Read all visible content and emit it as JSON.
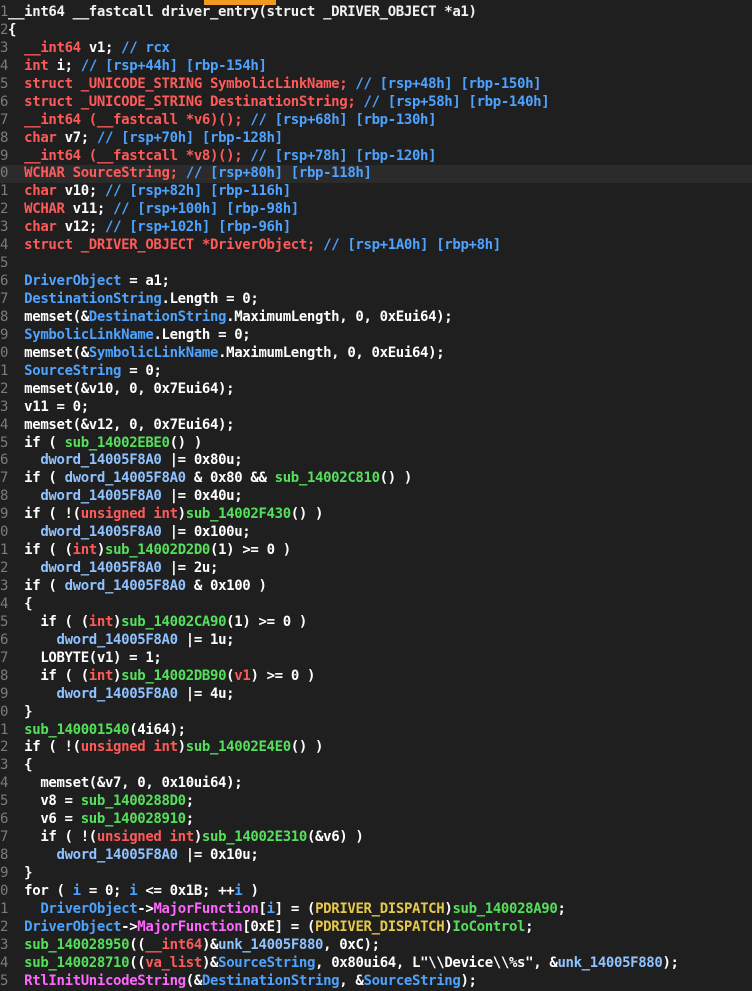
{
  "window": {
    "title": ""
  },
  "colors": {
    "background": "#1f1f1f",
    "current_line": "#2b2b2b",
    "line_number": "#7c7c7c",
    "comment": "#4da3ff",
    "type_keyword": "#ff5a5a",
    "function": "#55e05c",
    "global_var": "#8fc2ff",
    "member": "#ff66ff"
  },
  "code": {
    "highlighted_line": 9,
    "lines": [
      {
        "n": "1",
        "segs": [
          {
            "t": "__int64 __fastcall driver_entry(struct _DRIVER_OBJECT *a1)",
            "c": "k"
          }
        ]
      },
      {
        "n": "2",
        "segs": [
          {
            "t": "{",
            "c": "p"
          }
        ]
      },
      {
        "n": "3",
        "segs": [
          {
            "t": "  ",
            "c": "p"
          },
          {
            "t": "__int64",
            "c": "t"
          },
          {
            "t": " v1; ",
            "c": "v"
          },
          {
            "t": "// rcx",
            "c": "c"
          }
        ]
      },
      {
        "n": "4",
        "segs": [
          {
            "t": "  ",
            "c": "p"
          },
          {
            "t": "int",
            "c": "t"
          },
          {
            "t": " i; ",
            "c": "v"
          },
          {
            "t": "// [rsp+44h] [rbp-154h]",
            "c": "c"
          }
        ]
      },
      {
        "n": "5",
        "segs": [
          {
            "t": "  ",
            "c": "p"
          },
          {
            "t": "struct _UNICODE_STRING SymbolicLinkName;",
            "c": "t"
          },
          {
            "t": " ",
            "c": "p"
          },
          {
            "t": "// [rsp+48h] [rbp-150h]",
            "c": "c"
          }
        ]
      },
      {
        "n": "6",
        "segs": [
          {
            "t": "  ",
            "c": "p"
          },
          {
            "t": "struct _UNICODE_STRING DestinationString;",
            "c": "t"
          },
          {
            "t": " ",
            "c": "p"
          },
          {
            "t": "// [rsp+58h] [rbp-140h]",
            "c": "c"
          }
        ]
      },
      {
        "n": "7",
        "segs": [
          {
            "t": "  ",
            "c": "p"
          },
          {
            "t": "__int64 (__fastcall *v6)();",
            "c": "t"
          },
          {
            "t": " ",
            "c": "p"
          },
          {
            "t": "// [rsp+68h] [rbp-130h]",
            "c": "c"
          }
        ]
      },
      {
        "n": "8",
        "segs": [
          {
            "t": "  ",
            "c": "p"
          },
          {
            "t": "char",
            "c": "t"
          },
          {
            "t": " v7; ",
            "c": "v"
          },
          {
            "t": "// [rsp+70h] [rbp-128h]",
            "c": "c"
          }
        ]
      },
      {
        "n": "9",
        "segs": [
          {
            "t": "  ",
            "c": "p"
          },
          {
            "t": "__int64 (__fastcall *v8)();",
            "c": "t"
          },
          {
            "t": " ",
            "c": "p"
          },
          {
            "t": "// [rsp+78h] [rbp-120h]",
            "c": "c"
          }
        ]
      },
      {
        "n": "0",
        "segs": [
          {
            "t": "  ",
            "c": "p"
          },
          {
            "t": "WCHAR SourceString;",
            "c": "t"
          },
          {
            "t": " ",
            "c": "p"
          },
          {
            "t": "// [rsp+80h] [rbp-118h]",
            "c": "c"
          }
        ]
      },
      {
        "n": "1",
        "segs": [
          {
            "t": "  ",
            "c": "p"
          },
          {
            "t": "char",
            "c": "t"
          },
          {
            "t": " v10; ",
            "c": "v"
          },
          {
            "t": "// [rsp+82h] [rbp-116h]",
            "c": "c"
          }
        ]
      },
      {
        "n": "2",
        "segs": [
          {
            "t": "  ",
            "c": "p"
          },
          {
            "t": "WCHAR",
            "c": "t"
          },
          {
            "t": " v11; ",
            "c": "v"
          },
          {
            "t": "// [rsp+100h] [rbp-98h]",
            "c": "c"
          }
        ]
      },
      {
        "n": "3",
        "segs": [
          {
            "t": "  ",
            "c": "p"
          },
          {
            "t": "char",
            "c": "t"
          },
          {
            "t": " v12; ",
            "c": "v"
          },
          {
            "t": "// [rsp+102h] [rbp-96h]",
            "c": "c"
          }
        ]
      },
      {
        "n": "4",
        "segs": [
          {
            "t": "  ",
            "c": "p"
          },
          {
            "t": "struct _DRIVER_OBJECT *DriverObject;",
            "c": "t"
          },
          {
            "t": " ",
            "c": "p"
          },
          {
            "t": "// [rsp+1A0h] [rbp+8h]",
            "c": "c"
          }
        ]
      },
      {
        "n": "5",
        "segs": []
      },
      {
        "n": "6",
        "segs": [
          {
            "t": "  ",
            "c": "p"
          },
          {
            "t": "DriverObject",
            "c": "c"
          },
          {
            "t": " = a1;",
            "c": "v"
          }
        ]
      },
      {
        "n": "7",
        "segs": [
          {
            "t": "  ",
            "c": "p"
          },
          {
            "t": "DestinationString",
            "c": "c"
          },
          {
            "t": ".Length = 0;",
            "c": "p"
          }
        ]
      },
      {
        "n": "8",
        "segs": [
          {
            "t": "  memset(&",
            "c": "p"
          },
          {
            "t": "DestinationString",
            "c": "c"
          },
          {
            "t": ".MaximumLength, 0, 0xEui64);",
            "c": "p"
          }
        ]
      },
      {
        "n": "9",
        "segs": [
          {
            "t": "  ",
            "c": "p"
          },
          {
            "t": "SymbolicLinkName",
            "c": "c"
          },
          {
            "t": ".Length = 0;",
            "c": "p"
          }
        ]
      },
      {
        "n": "0",
        "segs": [
          {
            "t": "  memset(&",
            "c": "p"
          },
          {
            "t": "SymbolicLinkName",
            "c": "c"
          },
          {
            "t": ".MaximumLength, 0, 0xEui64);",
            "c": "p"
          }
        ]
      },
      {
        "n": "1",
        "segs": [
          {
            "t": "  ",
            "c": "p"
          },
          {
            "t": "SourceString",
            "c": "c"
          },
          {
            "t": " = 0;",
            "c": "p"
          }
        ]
      },
      {
        "n": "2",
        "segs": [
          {
            "t": "  memset(&v10, 0, 0x7Eui64);",
            "c": "p"
          }
        ]
      },
      {
        "n": "3",
        "segs": [
          {
            "t": "  v11 = 0;",
            "c": "p"
          }
        ]
      },
      {
        "n": "4",
        "segs": [
          {
            "t": "  memset(&v12, 0, 0x7Eui64);",
            "c": "p"
          }
        ]
      },
      {
        "n": "5",
        "segs": [
          {
            "t": "  if ( ",
            "c": "p"
          },
          {
            "t": "sub_14002EBE0",
            "c": "f"
          },
          {
            "t": "() )",
            "c": "p"
          }
        ]
      },
      {
        "n": "6",
        "segs": [
          {
            "t": "    ",
            "c": "p"
          },
          {
            "t": "dword_14005F8A0",
            "c": "g"
          },
          {
            "t": " |= 0x80u;",
            "c": "p"
          }
        ]
      },
      {
        "n": "7",
        "segs": [
          {
            "t": "  if ( ",
            "c": "p"
          },
          {
            "t": "dword_14005F8A0",
            "c": "g"
          },
          {
            "t": " & 0x80 && ",
            "c": "p"
          },
          {
            "t": "sub_14002C810",
            "c": "f"
          },
          {
            "t": "() )",
            "c": "p"
          }
        ]
      },
      {
        "n": "8",
        "segs": [
          {
            "t": "    ",
            "c": "p"
          },
          {
            "t": "dword_14005F8A0",
            "c": "g"
          },
          {
            "t": " |= 0x40u;",
            "c": "p"
          }
        ]
      },
      {
        "n": "9",
        "segs": [
          {
            "t": "  if ( !(",
            "c": "p"
          },
          {
            "t": "unsigned int",
            "c": "t2"
          },
          {
            "t": ")",
            "c": "p"
          },
          {
            "t": "sub_14002F430",
            "c": "f"
          },
          {
            "t": "() )",
            "c": "p"
          }
        ]
      },
      {
        "n": "0",
        "segs": [
          {
            "t": "    ",
            "c": "p"
          },
          {
            "t": "dword_14005F8A0",
            "c": "g"
          },
          {
            "t": " |= 0x100u;",
            "c": "p"
          }
        ]
      },
      {
        "n": "1",
        "segs": [
          {
            "t": "  if ( (",
            "c": "p"
          },
          {
            "t": "int",
            "c": "t2"
          },
          {
            "t": ")",
            "c": "p"
          },
          {
            "t": "sub_14002D2D0",
            "c": "f"
          },
          {
            "t": "(1) >= 0 )",
            "c": "p"
          }
        ]
      },
      {
        "n": "2",
        "segs": [
          {
            "t": "    ",
            "c": "p"
          },
          {
            "t": "dword_14005F8A0",
            "c": "g"
          },
          {
            "t": " |= 2u;",
            "c": "p"
          }
        ]
      },
      {
        "n": "3",
        "segs": [
          {
            "t": "  if ( ",
            "c": "p"
          },
          {
            "t": "dword_14005F8A0",
            "c": "g"
          },
          {
            "t": " & 0x100 )",
            "c": "p"
          }
        ]
      },
      {
        "n": "4",
        "segs": [
          {
            "t": "  {",
            "c": "p"
          }
        ]
      },
      {
        "n": "5",
        "segs": [
          {
            "t": "    if ( (",
            "c": "p"
          },
          {
            "t": "int",
            "c": "t2"
          },
          {
            "t": ")",
            "c": "p"
          },
          {
            "t": "sub_14002CA90",
            "c": "f"
          },
          {
            "t": "(1) >= 0 )",
            "c": "p"
          }
        ]
      },
      {
        "n": "6",
        "segs": [
          {
            "t": "      ",
            "c": "p"
          },
          {
            "t": "dword_14005F8A0",
            "c": "g"
          },
          {
            "t": " |= 1u;",
            "c": "p"
          }
        ]
      },
      {
        "n": "7",
        "segs": [
          {
            "t": "    LOBYTE(v1) = 1;",
            "c": "p"
          }
        ]
      },
      {
        "n": "8",
        "segs": [
          {
            "t": "    if ( (",
            "c": "p"
          },
          {
            "t": "int",
            "c": "t2"
          },
          {
            "t": ")",
            "c": "p"
          },
          {
            "t": "sub_14002DB90",
            "c": "f"
          },
          {
            "t": "(",
            "c": "p"
          },
          {
            "t": "v1",
            "c": "t"
          },
          {
            "t": ") >= 0 )",
            "c": "p"
          }
        ]
      },
      {
        "n": "9",
        "segs": [
          {
            "t": "      ",
            "c": "p"
          },
          {
            "t": "dword_14005F8A0",
            "c": "g"
          },
          {
            "t": " |= 4u;",
            "c": "p"
          }
        ]
      },
      {
        "n": "0",
        "segs": [
          {
            "t": "  }",
            "c": "p"
          }
        ]
      },
      {
        "n": "1",
        "segs": [
          {
            "t": "  ",
            "c": "p"
          },
          {
            "t": "sub_140001540",
            "c": "f"
          },
          {
            "t": "(4i64);",
            "c": "p"
          }
        ]
      },
      {
        "n": "2",
        "segs": [
          {
            "t": "  if ( !(",
            "c": "p"
          },
          {
            "t": "unsigned int",
            "c": "t2"
          },
          {
            "t": ")",
            "c": "p"
          },
          {
            "t": "sub_14002E4E0",
            "c": "f"
          },
          {
            "t": "() )",
            "c": "p"
          }
        ]
      },
      {
        "n": "3",
        "segs": [
          {
            "t": "  {",
            "c": "p"
          }
        ]
      },
      {
        "n": "4",
        "segs": [
          {
            "t": "    memset(&v7, 0, 0x10ui64);",
            "c": "p"
          }
        ]
      },
      {
        "n": "5",
        "segs": [
          {
            "t": "    v8 = ",
            "c": "p"
          },
          {
            "t": "sub_1400288D0",
            "c": "f"
          },
          {
            "t": ";",
            "c": "p"
          }
        ]
      },
      {
        "n": "6",
        "segs": [
          {
            "t": "    v6 = ",
            "c": "p"
          },
          {
            "t": "sub_140028910",
            "c": "f"
          },
          {
            "t": ";",
            "c": "p"
          }
        ]
      },
      {
        "n": "7",
        "segs": [
          {
            "t": "    if ( !(",
            "c": "p"
          },
          {
            "t": "unsigned int",
            "c": "t2"
          },
          {
            "t": ")",
            "c": "p"
          },
          {
            "t": "sub_14002E310",
            "c": "f"
          },
          {
            "t": "(&v6) )",
            "c": "p"
          }
        ]
      },
      {
        "n": "8",
        "segs": [
          {
            "t": "      ",
            "c": "p"
          },
          {
            "t": "dword_14005F8A0",
            "c": "g"
          },
          {
            "t": " |= 0x10u;",
            "c": "p"
          }
        ]
      },
      {
        "n": "9",
        "segs": [
          {
            "t": "  }",
            "c": "p"
          }
        ]
      },
      {
        "n": "0",
        "segs": [
          {
            "t": "  for ( ",
            "c": "p"
          },
          {
            "t": "i",
            "c": "c"
          },
          {
            "t": " = 0; ",
            "c": "p"
          },
          {
            "t": "i",
            "c": "c"
          },
          {
            "t": " <= 0x1B; ++",
            "c": "p"
          },
          {
            "t": "i",
            "c": "c"
          },
          {
            "t": " )",
            "c": "p"
          }
        ]
      },
      {
        "n": "1",
        "segs": [
          {
            "t": "    ",
            "c": "p"
          },
          {
            "t": "DriverObject",
            "c": "c"
          },
          {
            "t": "->",
            "c": "p"
          },
          {
            "t": "MajorFunction",
            "c": "m"
          },
          {
            "t": "[",
            "c": "p"
          },
          {
            "t": "i",
            "c": "c"
          },
          {
            "t": "] = (",
            "c": "p"
          },
          {
            "t": "PDRIVER_DISPATCH",
            "c": "j"
          },
          {
            "t": ")",
            "c": "p"
          },
          {
            "t": "sub_140028A90",
            "c": "f"
          },
          {
            "t": ";",
            "c": "p"
          }
        ]
      },
      {
        "n": "2",
        "segs": [
          {
            "t": "  ",
            "c": "p"
          },
          {
            "t": "DriverObject",
            "c": "c"
          },
          {
            "t": "->",
            "c": "p"
          },
          {
            "t": "MajorFunction",
            "c": "m"
          },
          {
            "t": "[0xE] = (",
            "c": "p"
          },
          {
            "t": "PDRIVER_DISPATCH",
            "c": "j"
          },
          {
            "t": ")",
            "c": "p"
          },
          {
            "t": "IoControl",
            "c": "f"
          },
          {
            "t": ";",
            "c": "p"
          }
        ]
      },
      {
        "n": "3",
        "segs": [
          {
            "t": "  ",
            "c": "p"
          },
          {
            "t": "sub_140028950",
            "c": "f"
          },
          {
            "t": "((",
            "c": "p"
          },
          {
            "t": "__int64",
            "c": "t"
          },
          {
            "t": ")&",
            "c": "p"
          },
          {
            "t": "unk_14005F880",
            "c": "g"
          },
          {
            "t": ", 0xC);",
            "c": "p"
          }
        ]
      },
      {
        "n": "4",
        "segs": [
          {
            "t": "  ",
            "c": "p"
          },
          {
            "t": "sub_140028710",
            "c": "f"
          },
          {
            "t": "((",
            "c": "p"
          },
          {
            "t": "va_list",
            "c": "t"
          },
          {
            "t": ")&",
            "c": "p"
          },
          {
            "t": "SourceString",
            "c": "c"
          },
          {
            "t": ", 0x80ui64, L\"\\\\Device\\\\%s\", &",
            "c": "p"
          },
          {
            "t": "unk_14005F880",
            "c": "g"
          },
          {
            "t": ");",
            "c": "p"
          }
        ]
      },
      {
        "n": "5",
        "segs": [
          {
            "t": "  ",
            "c": "p"
          },
          {
            "t": "RtlInitUnicodeString",
            "c": "m"
          },
          {
            "t": "(&",
            "c": "p"
          },
          {
            "t": "DestinationString",
            "c": "c"
          },
          {
            "t": ", &",
            "c": "p"
          },
          {
            "t": "SourceString",
            "c": "c"
          },
          {
            "t": ");",
            "c": "p"
          }
        ]
      }
    ]
  }
}
